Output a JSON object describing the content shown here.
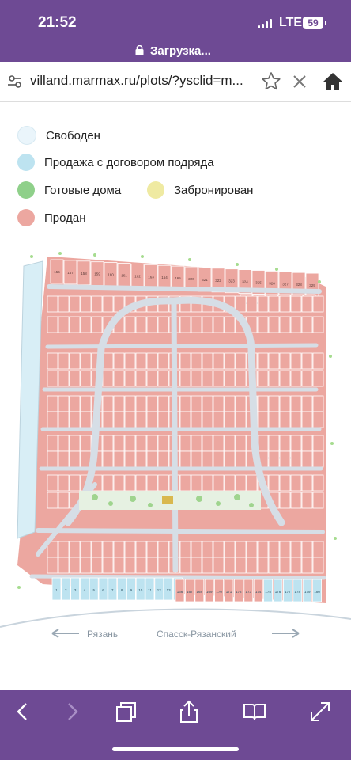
{
  "status": {
    "time": "21:52",
    "network": "LTE",
    "battery": "59"
  },
  "loading_text": "Загрузка...",
  "address_bar": {
    "url": "villand.marmax.ru/plots/?ysclid=m..."
  },
  "legend": [
    {
      "label": "Свободен",
      "color": "#eaf5fb"
    },
    {
      "label": "Продажа с договором подряда",
      "color": "#bde3f0"
    },
    {
      "label": "Готовые дома",
      "color": "#8fd08a"
    },
    {
      "label": "Забронирован",
      "color": "#efeaa2"
    },
    {
      "label": "Продан",
      "color": "#eca7a0"
    }
  ],
  "map": {
    "plot_color_sold": "#eca7a0",
    "plot_color_contract": "#bde3f0",
    "road_color": "#d6dee6",
    "direction_left": "Рязань",
    "direction_right": "Спасск-Рязанский",
    "plot_labels": {
      "row_top": [
        "156",
        "157",
        "158",
        "159",
        "160",
        "161",
        "162",
        "163",
        "164",
        "165",
        "320",
        "321",
        "322",
        "323",
        "324",
        "325",
        "326",
        "327",
        "328",
        "329"
      ],
      "row_right": [
        "314",
        "315",
        "316",
        "317",
        "318",
        "319"
      ],
      "row_mid": [
        "241",
        "242",
        "243",
        "244",
        "245"
      ],
      "row_bottom": [
        "1",
        "2",
        "3",
        "4",
        "5",
        "6",
        "7",
        "8",
        "9",
        "10",
        "11",
        "12",
        "13",
        "14",
        "166",
        "167",
        "168",
        "169",
        "170",
        "171",
        "172",
        "173",
        "174",
        "175",
        "176",
        "177",
        "178",
        "179",
        "180"
      ]
    }
  },
  "icons": {
    "tune": "page-settings-icon",
    "star": "bookmark-star-icon",
    "close": "stop-loading-icon",
    "home": "home-icon",
    "back": "back-icon",
    "forward": "forward-icon",
    "tabs": "tabs-icon",
    "share": "share-icon",
    "bookmarks": "book-icon",
    "fullscreen": "expand-icon"
  }
}
